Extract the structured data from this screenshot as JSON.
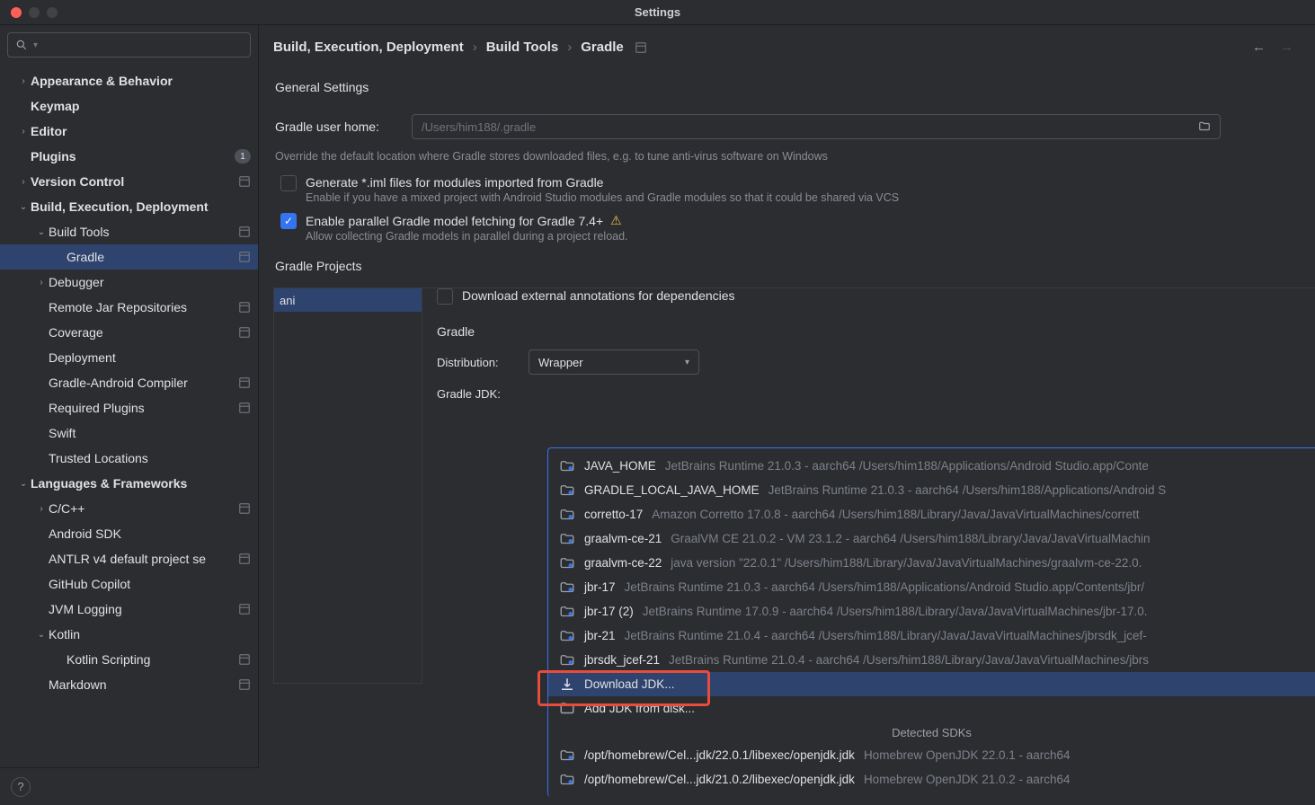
{
  "window": {
    "title": "Settings"
  },
  "search": {
    "placeholder": "Q"
  },
  "tree": [
    {
      "label": "Appearance & Behavior",
      "bold": true,
      "level": 0,
      "chev": ">"
    },
    {
      "label": "Keymap",
      "bold": true,
      "level": 0
    },
    {
      "label": "Editor",
      "bold": true,
      "level": 0,
      "chev": ">"
    },
    {
      "label": "Plugins",
      "bold": true,
      "level": 0,
      "badge": "1"
    },
    {
      "label": "Version Control",
      "bold": true,
      "level": 0,
      "chev": ">",
      "trail": true
    },
    {
      "label": "Build, Execution, Deployment",
      "bold": true,
      "level": 0,
      "chev": "v"
    },
    {
      "label": "Build Tools",
      "bold": false,
      "level": 1,
      "chev": "v",
      "trail": true
    },
    {
      "label": "Gradle",
      "bold": false,
      "level": 2,
      "sel": true,
      "trail": true
    },
    {
      "label": "Debugger",
      "bold": false,
      "level": 1,
      "chev": ">"
    },
    {
      "label": "Remote Jar Repositories",
      "bold": false,
      "level": 1,
      "trail": true
    },
    {
      "label": "Coverage",
      "bold": false,
      "level": 1,
      "trail": true
    },
    {
      "label": "Deployment",
      "bold": false,
      "level": 1
    },
    {
      "label": "Gradle-Android Compiler",
      "bold": false,
      "level": 1,
      "trail": true
    },
    {
      "label": "Required Plugins",
      "bold": false,
      "level": 1,
      "trail": true
    },
    {
      "label": "Swift",
      "bold": false,
      "level": 1
    },
    {
      "label": "Trusted Locations",
      "bold": false,
      "level": 1
    },
    {
      "label": "Languages & Frameworks",
      "bold": true,
      "level": 0,
      "chev": "v"
    },
    {
      "label": "C/C++",
      "bold": false,
      "level": 1,
      "chev": ">",
      "trail": true
    },
    {
      "label": "Android SDK",
      "bold": false,
      "level": 1
    },
    {
      "label": "ANTLR v4 default project se",
      "bold": false,
      "level": 1,
      "trail": true
    },
    {
      "label": "GitHub Copilot",
      "bold": false,
      "level": 1
    },
    {
      "label": "JVM Logging",
      "bold": false,
      "level": 1,
      "trail": true
    },
    {
      "label": "Kotlin",
      "bold": false,
      "level": 1,
      "chev": "v"
    },
    {
      "label": "Kotlin Scripting",
      "bold": false,
      "level": 2,
      "trail": true
    },
    {
      "label": "Markdown",
      "bold": false,
      "level": 1,
      "trail": true
    }
  ],
  "breadcrumbs": [
    "Build, Execution, Deployment",
    "Build Tools",
    "Gradle"
  ],
  "general": {
    "title": "General Settings",
    "user_home_label": "Gradle user home:",
    "user_home_placeholder": "/Users/him188/.gradle",
    "user_home_caption": "Override the default location where Gradle stores downloaded files, e.g. to tune anti-virus software on Windows",
    "iml_label": "Generate *.iml files for modules imported from Gradle",
    "iml_caption": "Enable if you have a mixed project with Android Studio modules and Gradle modules so that it could be shared via VCS",
    "parallel_label": "Enable parallel Gradle model fetching for Gradle 7.4+",
    "parallel_caption": "Allow collecting Gradle models in parallel during a project reload."
  },
  "projects": {
    "title": "Gradle Projects",
    "list": [
      "ani"
    ],
    "annotations_label": "Download external annotations for dependencies",
    "section": "Gradle",
    "dist_label": "Distribution:",
    "dist_value": "Wrapper",
    "jdk_label": "Gradle JDK:"
  },
  "jdk": {
    "items": [
      {
        "label": "JAVA_HOME",
        "sub": "JetBrains Runtime 21.0.3 - aarch64 /Users/him188/Applications/Android Studio.app/Conte"
      },
      {
        "label": "GRADLE_LOCAL_JAVA_HOME",
        "sub": "JetBrains Runtime 21.0.3 - aarch64 /Users/him188/Applications/Android S"
      },
      {
        "label": "corretto-17",
        "sub": "Amazon Corretto 17.0.8 - aarch64 /Users/him188/Library/Java/JavaVirtualMachines/corrett"
      },
      {
        "label": "graalvm-ce-21",
        "sub": "GraalVM CE 21.0.2 - VM 23.1.2 - aarch64 /Users/him188/Library/Java/JavaVirtualMachin"
      },
      {
        "label": "graalvm-ce-22",
        "sub": "java version \"22.0.1\" /Users/him188/Library/Java/JavaVirtualMachines/graalvm-ce-22.0."
      },
      {
        "label": "jbr-17",
        "sub": "JetBrains Runtime 21.0.3 - aarch64 /Users/him188/Applications/Android Studio.app/Contents/jbr/"
      },
      {
        "label": "jbr-17 (2)",
        "sub": "JetBrains Runtime 17.0.9 - aarch64 /Users/him188/Library/Java/JavaVirtualMachines/jbr-17.0."
      },
      {
        "label": "jbr-21",
        "sub": "JetBrains Runtime 21.0.4 - aarch64 /Users/him188/Library/Java/JavaVirtualMachines/jbrsdk_jcef-"
      },
      {
        "label": "jbrsdk_jcef-21",
        "sub": "JetBrains Runtime 21.0.4 - aarch64 /Users/him188/Library/Java/JavaVirtualMachines/jbrs"
      }
    ],
    "download_label": "Download JDK...",
    "from_disk_label": "Add JDK from disk...",
    "detected_title": "Detected SDKs",
    "detected": [
      {
        "label": "/opt/homebrew/Cel...jdk/22.0.1/libexec/openjdk.jdk",
        "sub": "Homebrew OpenJDK 22.0.1 - aarch64"
      },
      {
        "label": "/opt/homebrew/Cel...jdk/21.0.2/libexec/openjdk.jdk",
        "sub": "Homebrew OpenJDK 21.0.2 - aarch64"
      }
    ]
  }
}
